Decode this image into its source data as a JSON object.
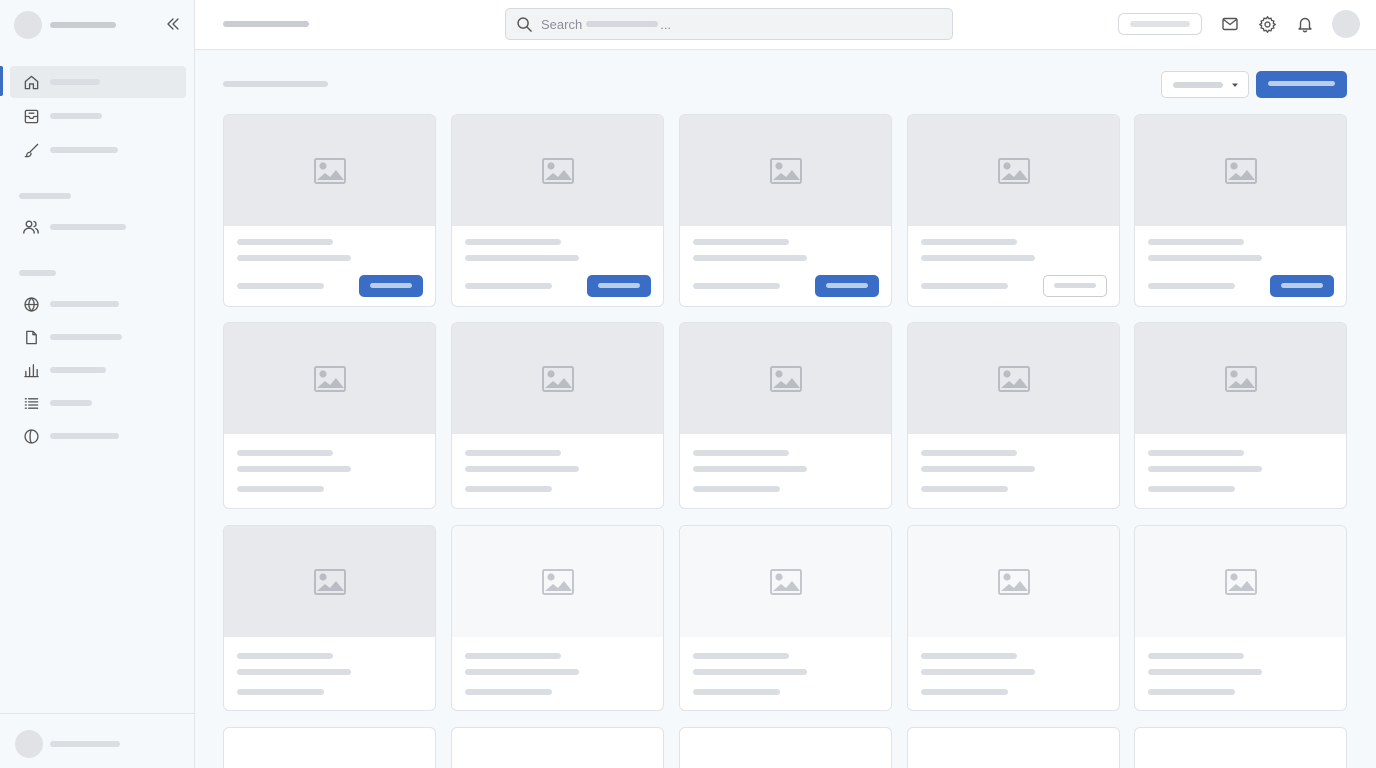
{
  "search": {
    "label": "Search",
    "ellipsis": "..."
  },
  "colors": {
    "accent": "#3a6dc5",
    "skeleton": "#dadde2",
    "media": "#e7e9ec",
    "background": "#f6f9fb"
  },
  "sidebar": {
    "collapse_icon": "chevrons-left-icon",
    "items": [
      {
        "icon": "home-icon",
        "active": true
      },
      {
        "icon": "inbox-icon",
        "active": false
      },
      {
        "icon": "brush-icon",
        "active": false
      },
      {
        "icon": "users-icon",
        "active": false
      },
      {
        "icon": "globe-icon",
        "active": false
      },
      {
        "icon": "file-icon",
        "active": false
      },
      {
        "icon": "bar-chart-icon",
        "active": false
      },
      {
        "icon": "list-icon",
        "active": false
      },
      {
        "icon": "circle-half-icon",
        "active": false
      }
    ]
  },
  "topbar_icons": [
    "mail-icon",
    "settings-icon",
    "bell-icon"
  ],
  "cards": [
    {
      "row": 1,
      "col": 1,
      "button": "primary"
    },
    {
      "row": 1,
      "col": 2,
      "button": "primary"
    },
    {
      "row": 1,
      "col": 3,
      "button": "primary"
    },
    {
      "row": 1,
      "col": 4,
      "button": "outline"
    },
    {
      "row": 1,
      "col": 5,
      "button": "primary"
    }
  ]
}
